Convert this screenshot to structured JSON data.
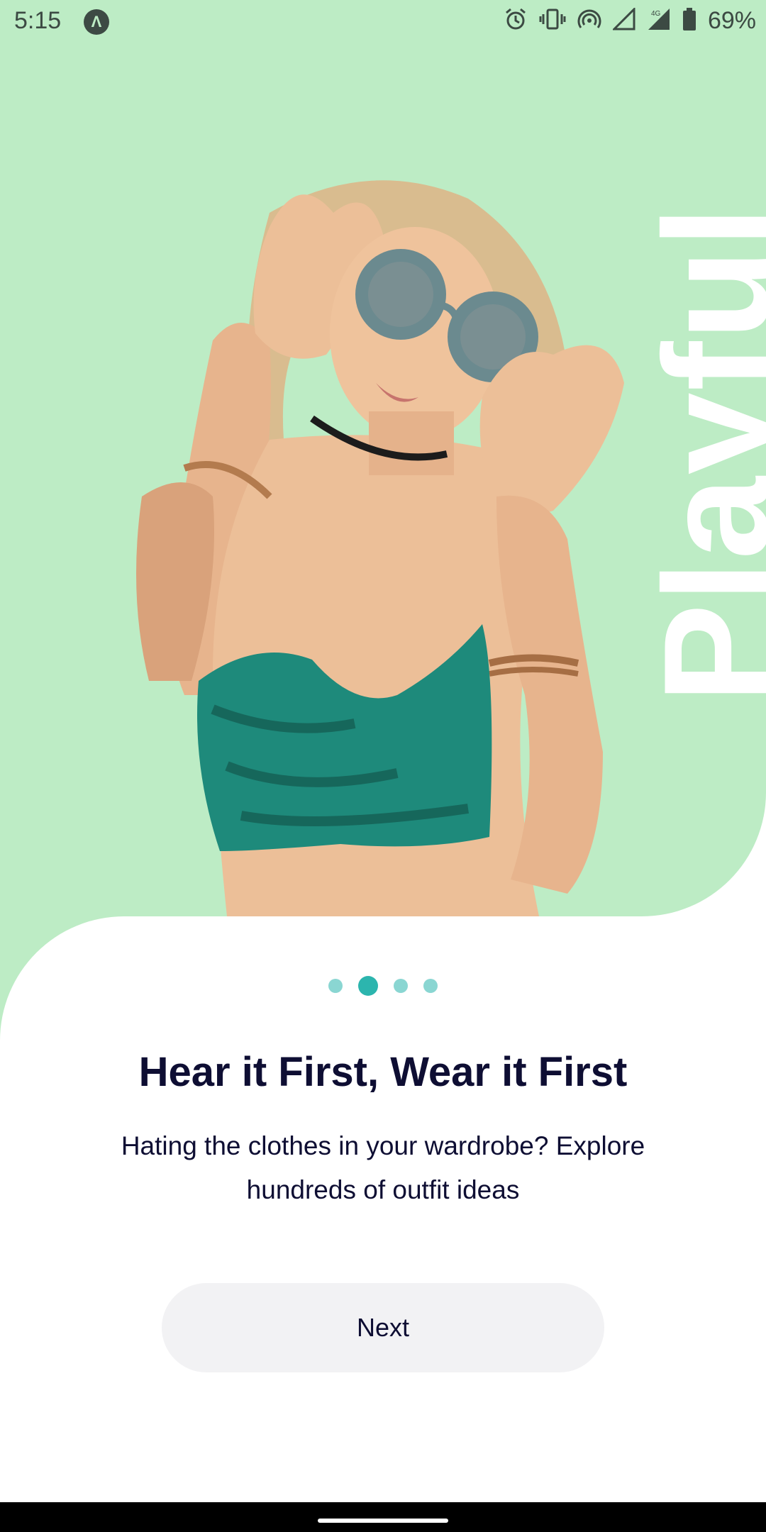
{
  "status_bar": {
    "time": "5:15",
    "app_badge": "Λ",
    "battery": "69%",
    "icons": [
      "alarm-icon",
      "vibrate-icon",
      "hotspot-icon",
      "signal-icon",
      "4g-signal-icon",
      "battery-icon"
    ]
  },
  "hero": {
    "vertical_word": "Playful",
    "background_color": "#bdecc5"
  },
  "pager": {
    "count": 4,
    "active_index": 1
  },
  "content": {
    "title": "Hear it First, Wear it First",
    "description": "Hating the clothes in your wardrobe? Explore hundreds of outfit ideas"
  },
  "actions": {
    "next_label": "Next"
  },
  "colors": {
    "accent": "#2cb5ae",
    "dot_inactive": "#8ad6d2",
    "text_dark": "#0e0e33",
    "button_bg": "#f2f2f4"
  }
}
